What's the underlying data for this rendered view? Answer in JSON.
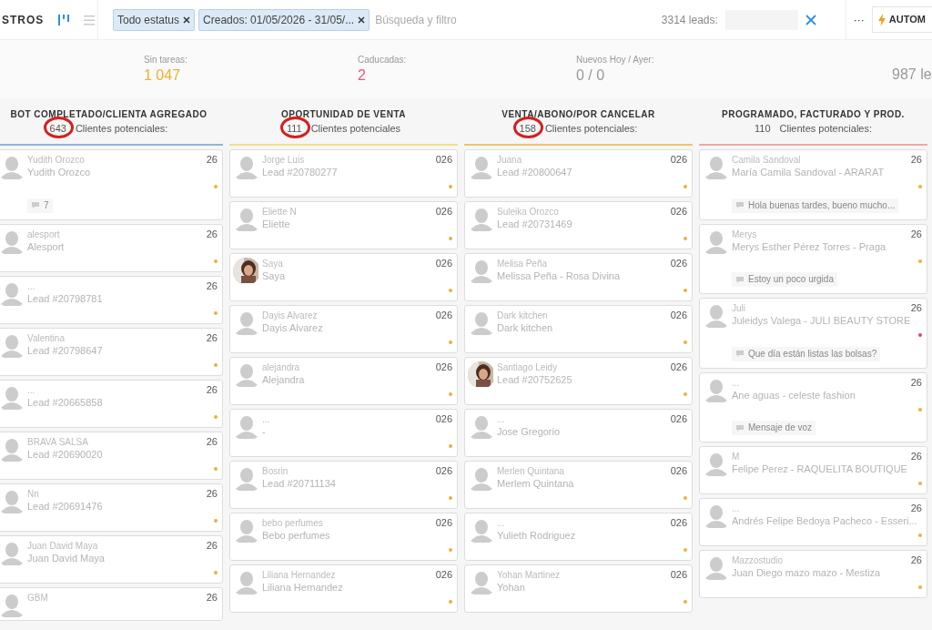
{
  "toolbar": {
    "title": "STROS",
    "views": [
      {
        "kind": "kanban",
        "selected": true
      },
      {
        "kind": "list",
        "selected": false
      }
    ],
    "filters": [
      {
        "label": "Todo estatus"
      },
      {
        "label": "Creados: 01/05/2026 - 31/05/..."
      }
    ],
    "search": {
      "placeholder": "Búsqueda y filtro"
    },
    "total": "3314 leads:",
    "more": "···",
    "automation_button": "AUTOM"
  },
  "stats": [
    {
      "label": "Sin tareas:",
      "value": "1 047",
      "color": "#f0b030"
    },
    {
      "label": "Caducadas:",
      "value": "2",
      "color": "#e8567a"
    },
    {
      "label": "Nuevos Hoy / Ayer:",
      "value": "0 / 0",
      "color": "#999999"
    },
    {
      "value": "987 le",
      "color": "#999999"
    }
  ],
  "columns": [
    {
      "title": "BOT COMPLETADO/CLIENTA AGREGADO",
      "count": "643",
      "count_label": "Clientes potenciales:",
      "circled": true,
      "color": "#8fb4dd",
      "cards": [
        {
          "subtitle": "Yudith Orozco",
          "name": "Yudith Orozco",
          "date": "26",
          "kind": "silhouette",
          "color": "#e3b341",
          "note": "7"
        },
        {
          "subtitle": "alesport",
          "name": "Alesport",
          "date": "26",
          "kind": "silhouette",
          "color": "#e3b341"
        },
        {
          "subtitle": "...",
          "name": "Lead #20798781",
          "date": "26",
          "kind": "silhouette",
          "color": "#e3b341"
        },
        {
          "subtitle": "Valentina",
          "name": "Lead #20798647",
          "date": "26",
          "kind": "silhouette",
          "color": "#e3b341"
        },
        {
          "subtitle": "...",
          "name": "Lead #20665858",
          "date": "26",
          "kind": "silhouette",
          "color": "#e3b341"
        },
        {
          "subtitle": "BRAVA SALSA",
          "name": "Lead #20690020",
          "date": "26",
          "kind": "silhouette",
          "color": "#e3b341"
        },
        {
          "subtitle": "Nn",
          "name": "Lead #20691476",
          "date": "26",
          "kind": "silhouette",
          "color": "#e3b341"
        },
        {
          "subtitle": "Juan David Maya",
          "name": "Juan David Maya",
          "date": "26",
          "kind": "silhouette",
          "color": "#e3b341"
        },
        {
          "subtitle": "GBM",
          "date": "26",
          "kind": "silhouette"
        }
      ]
    },
    {
      "title": "OPORTUNIDAD DE VENTA",
      "count": "111",
      "count_label": "Clientes potenciales",
      "circled": true,
      "color": "#eee08a",
      "cards": [
        {
          "subtitle": "Jorge Luis",
          "name": "Lead #20780277",
          "date": "026",
          "kind": "silhouette",
          "color": "#e3b341"
        },
        {
          "subtitle": "Eliette N",
          "name": "Eliette",
          "date": "026",
          "kind": "silhouette",
          "color": "#e3b341"
        },
        {
          "subtitle": "Saya",
          "name": "Saya",
          "date": "026",
          "color": "#e3b341"
        },
        {
          "subtitle": "Dayis Alvarez",
          "name": "Dayis Alvarez",
          "date": "026",
          "kind": "silhouette",
          "color": "#e3b341"
        },
        {
          "subtitle": "alejandra",
          "name": "Alejandra",
          "date": "026",
          "kind": "silhouette",
          "color": "#e3b341"
        },
        {
          "subtitle": "...",
          "name": "-",
          "date": "026",
          "kind": "silhouette",
          "color": "#e3b341"
        },
        {
          "subtitle": "Bosrin",
          "name": "Lead #20711134",
          "date": "026",
          "kind": "silhouette",
          "color": "#e3b341"
        },
        {
          "subtitle": "bebo perfumes",
          "name": "Bebo perfumes",
          "date": "026",
          "kind": "silhouette",
          "color": "#e3b341"
        },
        {
          "subtitle": "Liliana Hernandez",
          "name": "Liliana Hernandez",
          "date": "026",
          "kind": "silhouette",
          "color": "#e3b341"
        }
      ]
    },
    {
      "title": "VENTA/ABONO/POR CANCELAR",
      "count": "158",
      "count_label": "Clientes potenciales:",
      "circled": true,
      "color": "#f0c26a",
      "cards": [
        {
          "subtitle": "Juana",
          "name": "Lead #20800647",
          "date": "026",
          "kind": "silhouette",
          "color": "#e3b341"
        },
        {
          "subtitle": "Suleika Orozco",
          "name": "Lead #20731469",
          "date": "026",
          "kind": "silhouette",
          "color": "#e3b341"
        },
        {
          "subtitle": "Melisa Peña",
          "name": "Melissa Peña - Rosa Divina",
          "date": "026",
          "kind": "silhouette",
          "color": "#e3b341"
        },
        {
          "subtitle": "Dark kitchen",
          "name": "Dark kitchen",
          "date": "026",
          "kind": "silhouette",
          "color": "#e3b341"
        },
        {
          "subtitle": "Santiago Leidy",
          "name": "Lead #20752625",
          "date": "026",
          "color": "#e3b341"
        },
        {
          "subtitle": "...",
          "name": "Jose Gregorio",
          "date": "026",
          "kind": "silhouette"
        },
        {
          "subtitle": "Merlen Quintana",
          "name": "Merlem Quintana",
          "date": "026",
          "kind": "silhouette",
          "color": "#e3b341"
        },
        {
          "subtitle": "...",
          "name": "Yulieth Rodriguez",
          "date": "026",
          "kind": "silhouette",
          "color": "#e3b341"
        },
        {
          "subtitle": "Yohan Martinez",
          "name": "Yohan",
          "date": "026",
          "kind": "silhouette",
          "color": "#e3b341"
        }
      ]
    },
    {
      "title": "PROGRAMADO, FACTURADO Y PROD.",
      "count": "110",
      "count_label": "Clientes potenciales:",
      "circled": false,
      "color": "#f0a8a8",
      "cards": [
        {
          "subtitle": "Camila Sandoval",
          "name": "María Camila Sandoval - ARARAT",
          "date": "26",
          "kind": "silhouette",
          "color": "#e3b341",
          "note": "Hola buenas tardes, bueno mucho..."
        },
        {
          "subtitle": "Merys",
          "name": "Merys Esther Pérez Torres - Praga",
          "date": "26",
          "kind": "silhouette",
          "color": "#e3b341",
          "note": "Estoy un poco urgida"
        },
        {
          "subtitle": "Juli",
          "name": "Juleidys Valega - JULI BEAUTY STORE",
          "date": "26",
          "kind": "silhouette",
          "color": "#e0407a",
          "note": "Que día están listas las bolsas?"
        },
        {
          "subtitle": "...",
          "name": "Ane aguas - celeste fashion",
          "date": "26",
          "kind": "silhouette",
          "color": "#e3b341",
          "note": "Mensaje de voz"
        },
        {
          "subtitle": "M",
          "name": "Felipe Perez - RAQUELITA BOUTIQUE",
          "date": "26",
          "kind": "silhouette",
          "color": "#e3b341"
        },
        {
          "subtitle": "...",
          "name": "Andrés Felipe Bedoya Pacheco - Esseri...",
          "date": "26",
          "kind": "silhouette",
          "color": "#e3b341"
        },
        {
          "subtitle": "Mazzostudio",
          "name": "Juan Diego mazo mazo - Mestiza",
          "date": "26",
          "kind": "silhouette",
          "color": "#e3b341"
        }
      ]
    }
  ]
}
